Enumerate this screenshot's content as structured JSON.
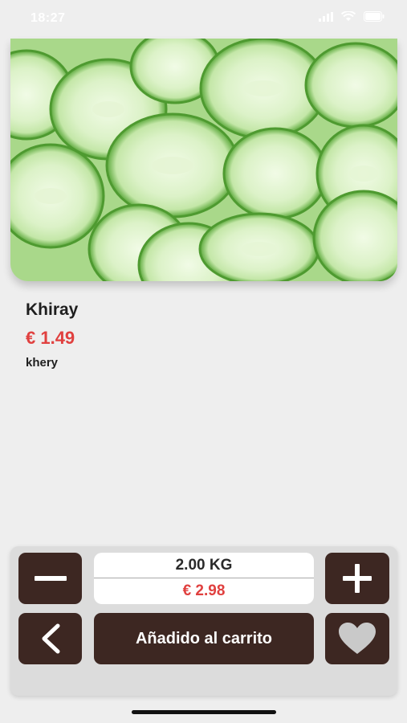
{
  "status_bar": {
    "time": "18:27"
  },
  "product": {
    "name": "Khiray",
    "price": "€ 1.49",
    "description": "khery"
  },
  "quantity": {
    "weight": "2.00 KG",
    "total": "€ 2.98"
  },
  "actions": {
    "add_to_cart_label": "Añadido al carrito"
  },
  "colors": {
    "button_bg": "#3d2722",
    "price_red": "#e0403f",
    "panel_bg": "#dcdcdc",
    "page_bg": "#eeeeee"
  },
  "icons": {
    "decrement": "minus-icon",
    "increment": "plus-icon",
    "back": "chevron-left-icon",
    "favorite": "heart-icon"
  }
}
